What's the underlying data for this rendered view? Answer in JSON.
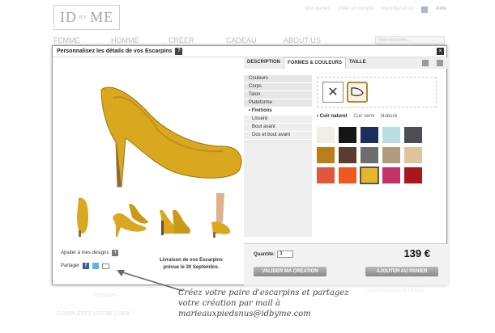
{
  "header": {
    "logo_text_left": "ID",
    "logo_text_small": "BY",
    "logo_text_right": "ME",
    "top_links": [
      "Mon panier",
      "Créer un compte",
      "Identifiez-vous"
    ],
    "help": "Aide"
  },
  "nav": [
    "FEMME",
    "HOMME",
    "CRÉER",
    "CADEAU",
    "ABOUT US"
  ],
  "search": {
    "placeholder": "Votre recherche..."
  },
  "bg": {
    "share_label": "Partager",
    "complete_look": "COMPLÉTEZ VOTRE LOOK :",
    "delivery_note": "Livraison prévue le 14 Août"
  },
  "modal": {
    "title": "Personnalisez les détails de vos Escarpins",
    "help_badge": "?",
    "close": "×",
    "tabs": [
      "DESCRIPTION",
      "FORMES & COULEURS",
      "TAILLE"
    ],
    "options": [
      {
        "label": "Couleurs",
        "kind": "main"
      },
      {
        "label": "Corps",
        "kind": "main"
      },
      {
        "label": "Talon",
        "kind": "main"
      },
      {
        "label": "Plateforme",
        "kind": "main"
      },
      {
        "label": "• Finitions",
        "kind": "selected"
      },
      {
        "label": "Lisséré",
        "kind": "sub"
      },
      {
        "label": "Bout avant",
        "kind": "sub"
      },
      {
        "label": "Dos et bout avant",
        "kind": "sub"
      }
    ],
    "finishes": {
      "selected": "• Cuir naturel",
      "others": [
        "Cuir verni",
        "Nubuck"
      ]
    },
    "swatches": [
      {
        "color": "#f3eee4",
        "selected": false
      },
      {
        "color": "#151515",
        "selected": false
      },
      {
        "color": "#1d2f5c",
        "selected": false
      },
      {
        "color": "#b9dde0",
        "selected": false
      },
      {
        "color": "#4d4d55",
        "selected": false
      },
      {
        "color": "#b87e1a",
        "selected": false
      },
      {
        "color": "#5a3d2e",
        "selected": false
      },
      {
        "color": "#6e6e6e",
        "selected": false
      },
      {
        "color": "#b39a7e",
        "selected": false
      },
      {
        "color": "#e0c49e",
        "selected": false
      },
      {
        "color": "#e0573e",
        "selected": false
      },
      {
        "color": "#ee5a1e",
        "selected": false
      },
      {
        "color": "#e6b52a",
        "selected": true
      },
      {
        "color": "#c63067",
        "selected": false
      },
      {
        "color": "#a9161e",
        "selected": false
      }
    ],
    "add_designs": "Ajouter à mes designs",
    "add_icon": "+",
    "share": "Partager",
    "share_fb": "f",
    "delivery_line1": "Livraison de vos Escarpins",
    "delivery_line2": "prévue le 30 Septembre.",
    "quantity_label": "Quantité:",
    "quantity_value": "1",
    "price": "139 €",
    "validate_button": "VALIDER MA CRÉATION",
    "cart_button": "AJOUTER AU PANIER"
  },
  "annotation": {
    "line1": "Créez votre paire d'escarpins et partagez",
    "line2": "votre création par mail à",
    "line3": "marieauxpiedsnus@idbyme.com"
  },
  "colors": {
    "shoe_yellow": "#d9a81e",
    "heel_brown": "#8a6a3f"
  }
}
